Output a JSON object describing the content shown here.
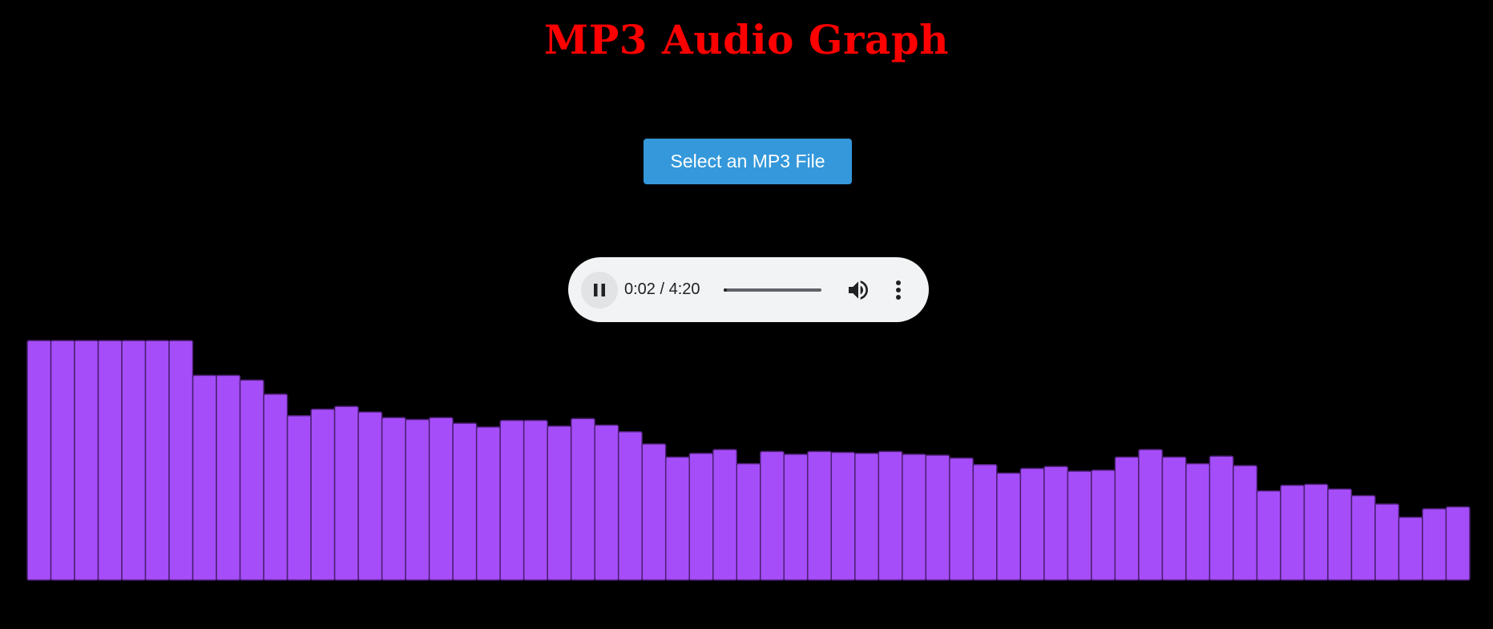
{
  "page": {
    "title": "MP3 Audio Graph",
    "select_button_label": "Select an MP3 File"
  },
  "player": {
    "state": "playing",
    "time_display": "0:02 / 4:20",
    "current_time": "0:02",
    "duration": "4:20",
    "progress_fraction": 0.008,
    "play_pause_icon": "pause-icon",
    "volume_icon": "volume-icon",
    "more_icon": "more-vert-icon"
  },
  "colors": {
    "background": "#000000",
    "title": "#ff0000",
    "button": "#3498db",
    "button_text": "#ffffff",
    "bars": "#a64dfa",
    "bar_border": "#4a1f70",
    "player_bg": "#f1f3f4"
  },
  "chart_data": {
    "type": "bar",
    "title": "",
    "xlabel": "",
    "ylabel": "",
    "ylim": [
      0,
      255
    ],
    "bar_count": 61,
    "values": [
      255,
      255,
      255,
      255,
      255,
      255,
      255,
      218,
      218,
      213,
      198,
      175,
      182,
      185,
      179,
      173,
      171,
      173,
      167,
      163,
      170,
      170,
      164,
      172,
      165,
      158,
      145,
      131,
      135,
      139,
      124,
      137,
      134,
      137,
      136,
      135,
      137,
      134,
      133,
      130,
      123,
      114,
      119,
      121,
      116,
      117,
      131,
      139,
      131,
      124,
      132,
      122,
      95,
      101,
      102,
      97,
      90,
      81,
      67,
      76,
      78
    ]
  }
}
